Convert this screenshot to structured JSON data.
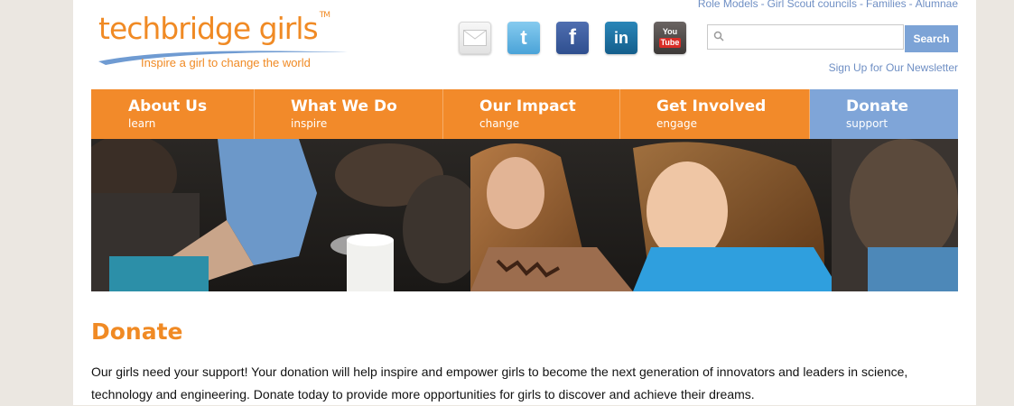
{
  "top_links": [
    "Role Models",
    "Girl Scout councils",
    "Families",
    "Alumnae"
  ],
  "top_link_separator": "-",
  "logo": {
    "wordmark": "techbridge girls",
    "tm": "TM",
    "tagline": "Inspire a girl to change the world"
  },
  "social": [
    {
      "name": "email",
      "glyph": ""
    },
    {
      "name": "twitter",
      "glyph": "t"
    },
    {
      "name": "facebook",
      "glyph": "f"
    },
    {
      "name": "linkedin",
      "glyph": "in"
    },
    {
      "name": "youtube",
      "glyph_top": "You",
      "glyph_bottom": "Tube"
    }
  ],
  "search": {
    "placeholder": "",
    "button_label": "Search"
  },
  "newsletter_link": "Sign Up for Our Newsletter",
  "nav": [
    {
      "title": "About Us",
      "sub": "learn"
    },
    {
      "title": "What We Do",
      "sub": "inspire"
    },
    {
      "title": "Our Impact",
      "sub": "change"
    },
    {
      "title": "Get Involved",
      "sub": "engage"
    },
    {
      "title": "Donate",
      "sub": "support"
    }
  ],
  "colors": {
    "accent_orange": "#f28a2a",
    "nav_blue": "#7fa5d8",
    "link_blue": "#6f8fc4"
  },
  "main": {
    "heading": "Donate",
    "paragraph": "Our girls need your support!  Your donation will help inspire and empower girls to become the next generation of innovators and leaders in science, technology and engineering. Donate today to provide more opportunities for girls to discover and achieve their dreams."
  }
}
